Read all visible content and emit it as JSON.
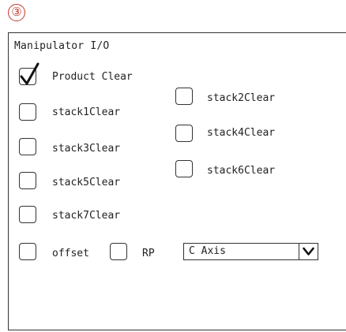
{
  "step_number": "③",
  "panel": {
    "title": "Manipulator  I/O",
    "items": {
      "product_clear": {
        "label": "Product Clear",
        "checked": true
      },
      "stack1": {
        "label": "stack1Clear",
        "checked": false
      },
      "stack2": {
        "label": "stack2Clear",
        "checked": false
      },
      "stack3": {
        "label": "stack3Clear",
        "checked": false
      },
      "stack4": {
        "label": "stack4Clear",
        "checked": false
      },
      "stack5": {
        "label": "stack5Clear",
        "checked": false
      },
      "stack6": {
        "label": "stack6Clear",
        "checked": false
      },
      "stack7": {
        "label": "stack7Clear",
        "checked": false
      },
      "offset": {
        "label": "offset",
        "checked": false
      },
      "rp": {
        "label": "RP",
        "checked": false
      }
    },
    "axis_select": {
      "value": "C Axis",
      "icon": "chevron-down-icon"
    }
  }
}
